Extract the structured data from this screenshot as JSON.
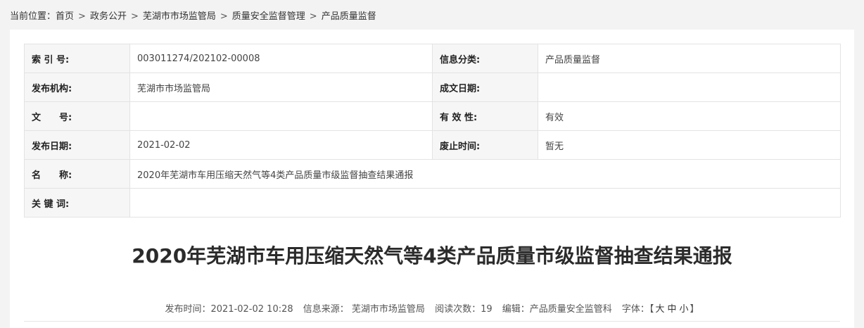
{
  "breadcrumb": {
    "prefix": "当前位置：",
    "items": [
      "首页",
      "政务公开",
      "芜湖市市场监管局",
      "质量安全监督管理",
      "产品质量监督"
    ],
    "separator": ">"
  },
  "meta_table": {
    "rows": [
      {
        "label1": "索 引 号:",
        "value1": "003011274/202102-00008",
        "label2": "信息分类:",
        "value2": "产品质量监督"
      },
      {
        "label1": "发布机构:",
        "value1": "芜湖市市场监管局",
        "label2": "成文日期:",
        "value2": ""
      },
      {
        "label1": "文　　号:",
        "value1": "",
        "label2": "有 效 性:",
        "value2": "有效"
      },
      {
        "label1": "发布日期:",
        "value1": "2021-02-02",
        "label2": "废止时间:",
        "value2": "暂无"
      }
    ],
    "name_label": "名　　称:",
    "name_value": "2020年芜湖市车用压缩天然气等4类产品质量市级监督抽查结果通报",
    "keywords_label": "关 键 词:",
    "keywords_value": ""
  },
  "article": {
    "title": "2020年芜湖市车用压缩天然气等4类产品质量市级监督抽查结果通报"
  },
  "info_bar": {
    "publish_time": "发布时间：2021-02-02 10:28",
    "source": "信息来源：  芜湖市市场监管局",
    "read_count": "阅读次数：19",
    "editor": "编辑：产品质量安全监管科",
    "font_label": "字体：",
    "font_open": "【",
    "font_large": "大",
    "font_medium": "中",
    "font_small": "小",
    "font_close": "】"
  }
}
